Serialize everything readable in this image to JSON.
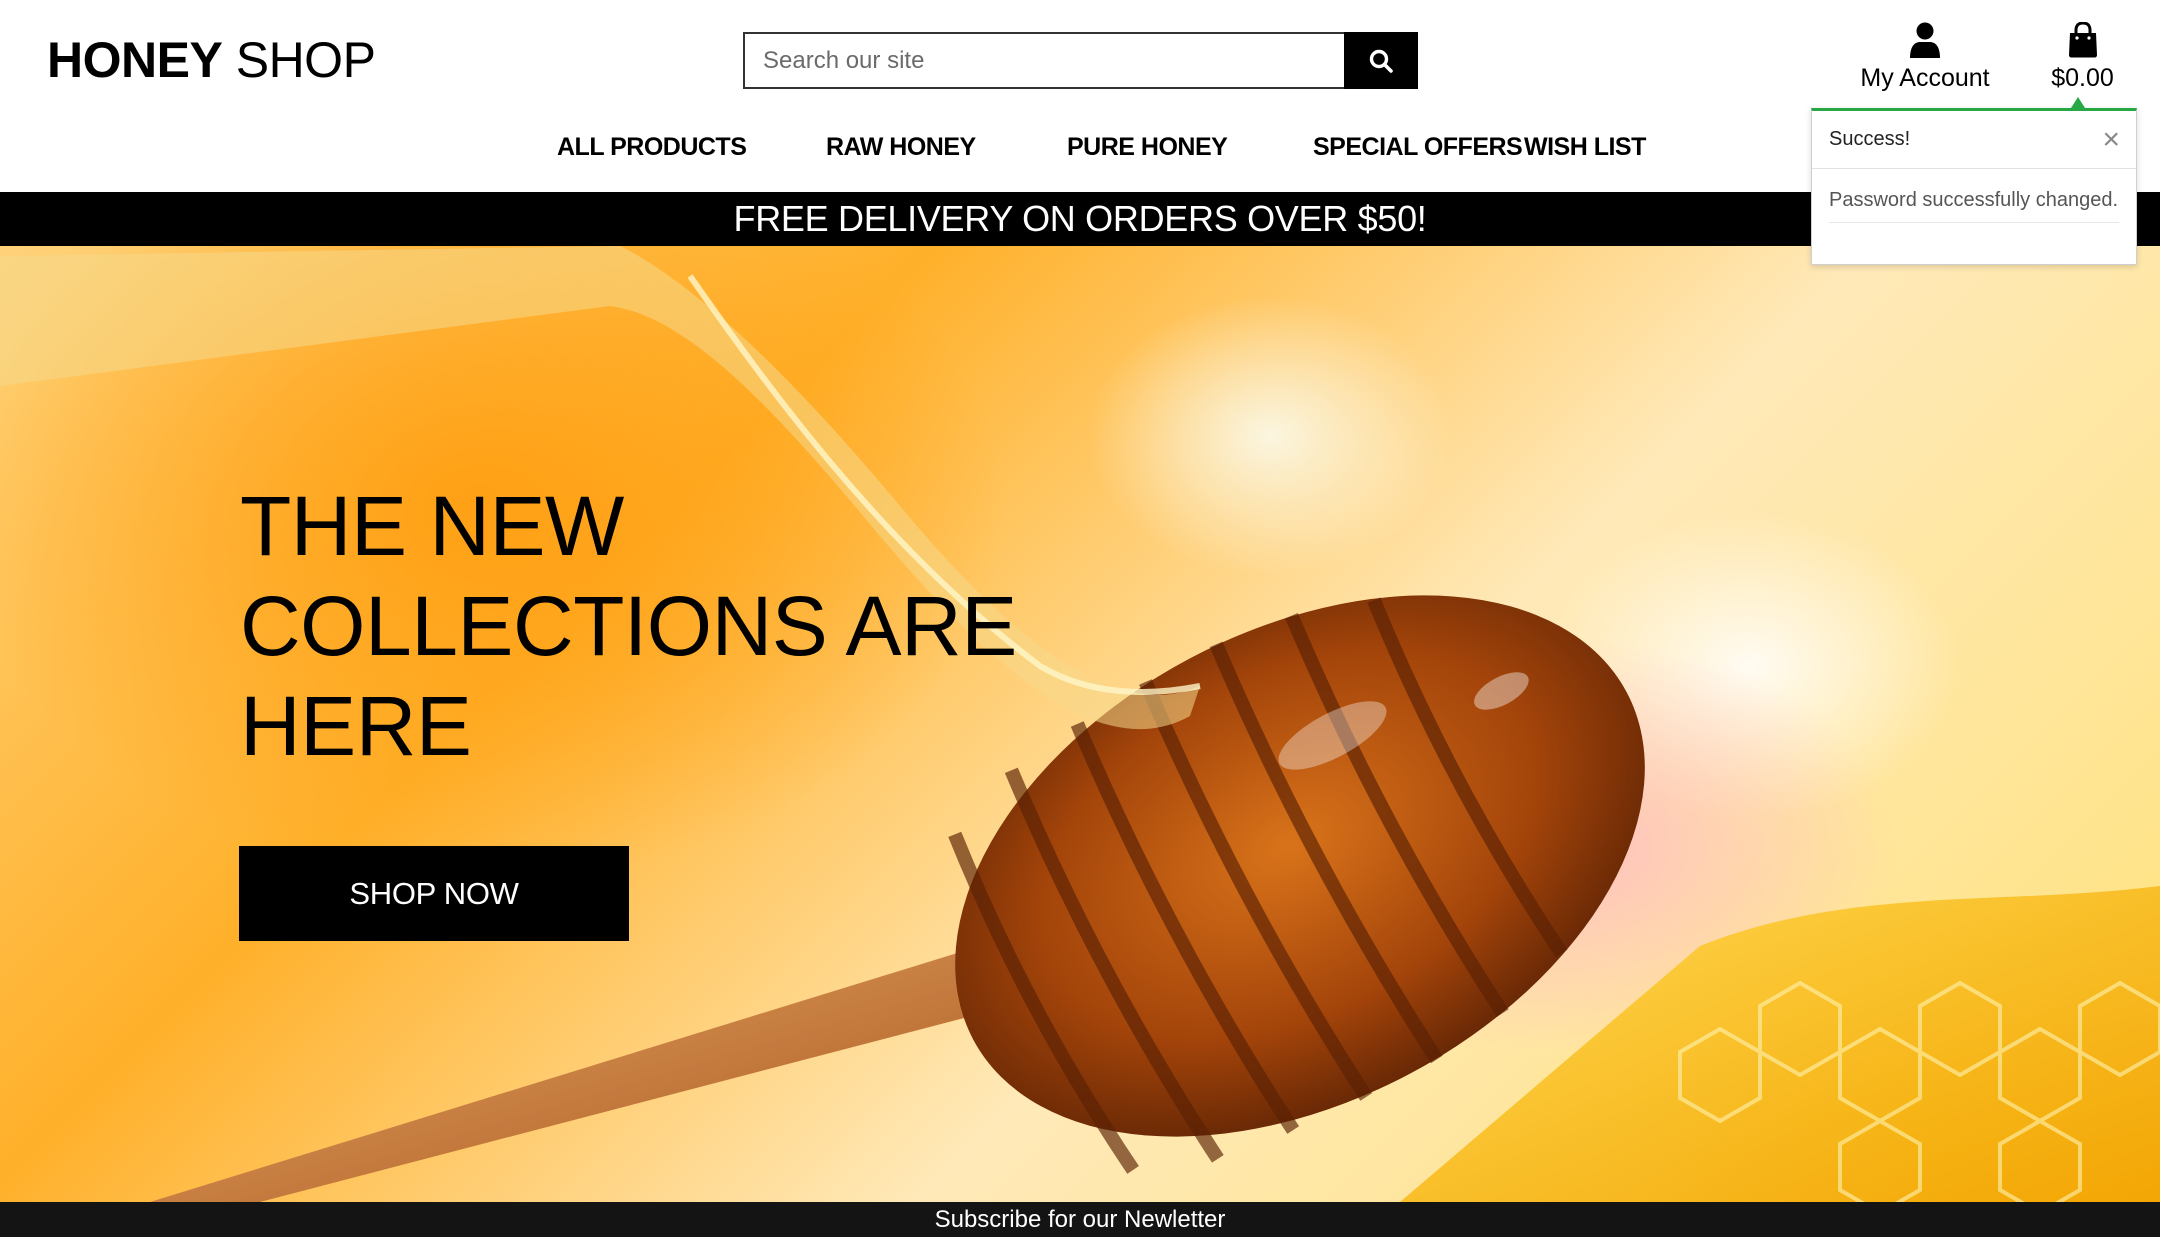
{
  "header": {
    "logo_bold": "HONEY",
    "logo_light": "SHOP",
    "search_placeholder": "Search our site",
    "account_label": "My Account",
    "cart_total": "$0.00"
  },
  "nav": {
    "items": [
      "ALL PRODUCTS",
      "RAW HONEY",
      "PURE HONEY",
      "SPECIAL OFFERS",
      "WISH LIST"
    ]
  },
  "banner": {
    "text": "FREE DELIVERY ON ORDERS OVER $50!"
  },
  "hero": {
    "title_line1": "THE NEW",
    "title_line2": "COLLECTIONS ARE",
    "title_line3": "HERE",
    "cta_label": "SHOP NOW"
  },
  "toast": {
    "title": "Success!",
    "message": "Password successfully changed.",
    "close_glyph": "×",
    "accent_color": "#28a745"
  },
  "footer": {
    "text": "Subscribe for our Newletter"
  },
  "icons": {
    "search": "search-icon",
    "account": "user-icon",
    "cart": "shopping-bag-icon",
    "close": "close-icon"
  }
}
